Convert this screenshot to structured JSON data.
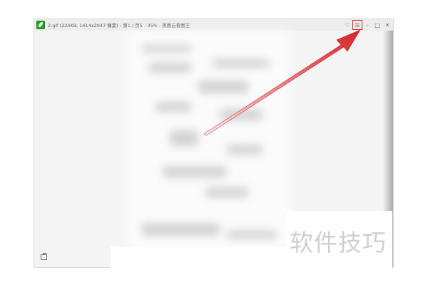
{
  "window": {
    "title": "2.gif (224KB, 1414x2047 像素) - 第1 / 页5 - 35% - 美图云看图王",
    "app_icon": "picture-viewer-leaf-icon",
    "controls": [
      "tshirt-skin-icon",
      "menu-icon",
      "minimize-icon",
      "maximize-icon",
      "close-icon"
    ],
    "control_glyphs": {
      "skin": "♡",
      "menu": "☰",
      "minimize": "–",
      "maximize": "□",
      "close": "✕"
    }
  },
  "viewport": {
    "bottom_left_icon": "toolbox-icon"
  },
  "annotation": {
    "arrow_color": "#d4222a",
    "highlight": "menu-button"
  },
  "watermark": {
    "text": "软件技巧"
  },
  "colors": {
    "app_green": "#1fa51f",
    "titlebar": "#ededed",
    "accent_red": "#d4222a"
  }
}
